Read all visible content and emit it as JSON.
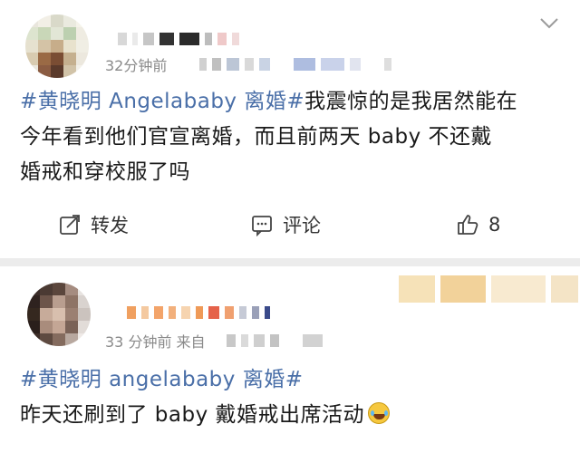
{
  "post1": {
    "time": "32分钟前",
    "hashtag": "#黄晓明 Angelababy 离婚#",
    "line1_rest": "我震惊的是我居然能在",
    "line2": "今年看到他们官宣离婚，而且前两天 baby 不还戴",
    "line3": "婚戒和穿校服了吗",
    "repost_label": "转发",
    "comment_label": "评论",
    "like_count": "8"
  },
  "post2": {
    "time": "33 分钟前  来自",
    "hashtag": "#黄晓明 angelababy 离婚#",
    "line2": "昨天还刷到了 baby 戴婚戒出席活动"
  },
  "colors": {
    "topic": "#4a6fa8",
    "background": "#ececec",
    "card": "#ffffff"
  },
  "icons": [
    "chevron-down-icon",
    "repost-icon",
    "comment-icon",
    "like-icon",
    "laugh-cry-emoji-icon"
  ]
}
